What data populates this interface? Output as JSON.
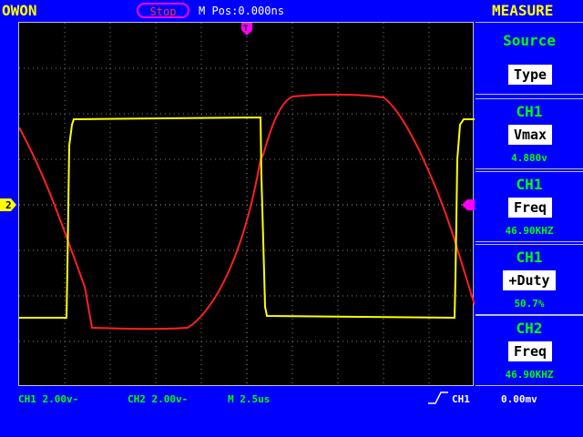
{
  "header": {
    "brand": "OWON",
    "run_state": "Stop",
    "mpos": "M Pos:0.000ns",
    "measure_title": "MEASURE"
  },
  "panel": {
    "source_label": "Source",
    "type_button": "Type",
    "measurements": [
      {
        "channel": "CH1",
        "type": "Vmax",
        "value": "4.880v"
      },
      {
        "channel": "CH1",
        "type": "Freq",
        "value": "46.90KHZ"
      },
      {
        "channel": "CH1",
        "type": "+Duty",
        "value": "50.7%"
      },
      {
        "channel": "CH2",
        "type": "Freq",
        "value": "46.90KHZ"
      }
    ]
  },
  "status": {
    "ch1_scale": "CH1 2.00v-",
    "ch2_scale": "CH2 2.00v-",
    "timebase": "M 2.5us",
    "trigger_source": "CH1",
    "trigger_level": "0.00mv"
  },
  "markers": {
    "ch2_ground_marker": "2",
    "trigger_marker": "T"
  },
  "colors": {
    "ch1_trace": "#ffff00",
    "ch2_trace": "#ff2020",
    "grid": "#808080",
    "background": "#0000ff",
    "screen": "#000000"
  }
}
